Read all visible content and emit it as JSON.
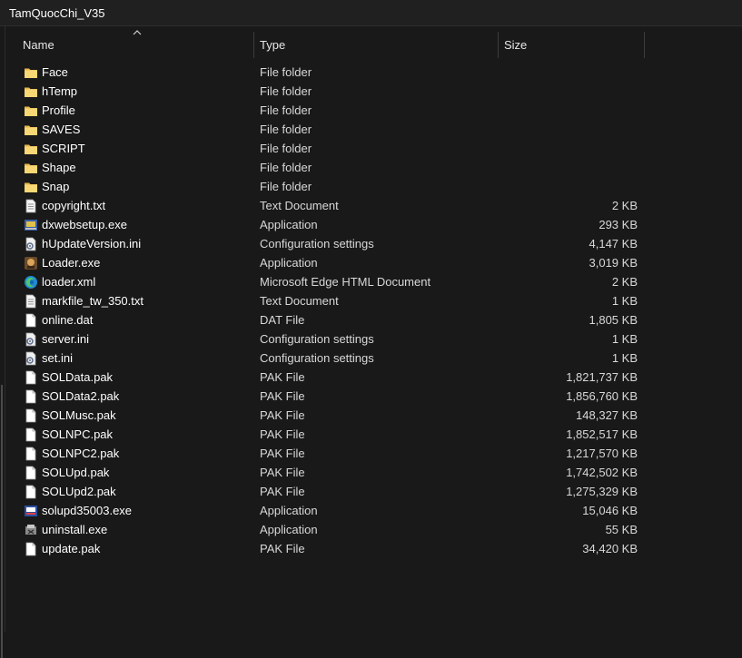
{
  "window": {
    "title": "TamQuocChi_V35"
  },
  "columns": {
    "name": "Name",
    "type": "Type",
    "size": "Size"
  },
  "files": [
    {
      "name": "Face",
      "type": "File folder",
      "size": "",
      "icon": "folder-icon"
    },
    {
      "name": "hTemp",
      "type": "File folder",
      "size": "",
      "icon": "folder-icon"
    },
    {
      "name": "Profile",
      "type": "File folder",
      "size": "",
      "icon": "folder-icon"
    },
    {
      "name": "SAVES",
      "type": "File folder",
      "size": "",
      "icon": "folder-icon"
    },
    {
      "name": "SCRIPT",
      "type": "File folder",
      "size": "",
      "icon": "folder-icon"
    },
    {
      "name": "Shape",
      "type": "File folder",
      "size": "",
      "icon": "folder-icon"
    },
    {
      "name": "Snap",
      "type": "File folder",
      "size": "",
      "icon": "folder-icon"
    },
    {
      "name": "copyright.txt",
      "type": "Text Document",
      "size": "2 KB",
      "icon": "text-file-icon"
    },
    {
      "name": "dxwebsetup.exe",
      "type": "Application",
      "size": "293 KB",
      "icon": "installer-icon"
    },
    {
      "name": "hUpdateVersion.ini",
      "type": "Configuration settings",
      "size": "4,147 KB",
      "icon": "settings-file-icon"
    },
    {
      "name": "Loader.exe",
      "type": "Application",
      "size": "3,019 KB",
      "icon": "game-app-icon"
    },
    {
      "name": "loader.xml",
      "type": "Microsoft Edge HTML Document",
      "size": "2 KB",
      "icon": "edge-icon"
    },
    {
      "name": "markfile_tw_350.txt",
      "type": "Text Document",
      "size": "1 KB",
      "icon": "text-file-icon"
    },
    {
      "name": "online.dat",
      "type": "DAT File",
      "size": "1,805 KB",
      "icon": "blank-file-icon"
    },
    {
      "name": "server.ini",
      "type": "Configuration settings",
      "size": "1 KB",
      "icon": "settings-file-icon"
    },
    {
      "name": "set.ini",
      "type": "Configuration settings",
      "size": "1 KB",
      "icon": "settings-file-icon"
    },
    {
      "name": "SOLData.pak",
      "type": "PAK File",
      "size": "1,821,737 KB",
      "icon": "blank-file-icon"
    },
    {
      "name": "SOLData2.pak",
      "type": "PAK File",
      "size": "1,856,760 KB",
      "icon": "blank-file-icon"
    },
    {
      "name": "SOLMusc.pak",
      "type": "PAK File",
      "size": "148,327 KB",
      "icon": "blank-file-icon"
    },
    {
      "name": "SOLNPC.pak",
      "type": "PAK File",
      "size": "1,852,517 KB",
      "icon": "blank-file-icon"
    },
    {
      "name": "SOLNPC2.pak",
      "type": "PAK File",
      "size": "1,217,570 KB",
      "icon": "blank-file-icon"
    },
    {
      "name": "SOLUpd.pak",
      "type": "PAK File",
      "size": "1,742,502 KB",
      "icon": "blank-file-icon"
    },
    {
      "name": "SOLUpd2.pak",
      "type": "PAK File",
      "size": "1,275,329 KB",
      "icon": "blank-file-icon"
    },
    {
      "name": "solupd35003.exe",
      "type": "Application",
      "size": "15,046 KB",
      "icon": "update-app-icon"
    },
    {
      "name": "uninstall.exe",
      "type": "Application",
      "size": "55 KB",
      "icon": "uninstall-app-icon"
    },
    {
      "name": "update.pak",
      "type": "PAK File",
      "size": "34,420 KB",
      "icon": "blank-file-icon"
    }
  ],
  "colors": {
    "background": "#191919",
    "folder": "#f8d775",
    "text": "#ffffff"
  }
}
